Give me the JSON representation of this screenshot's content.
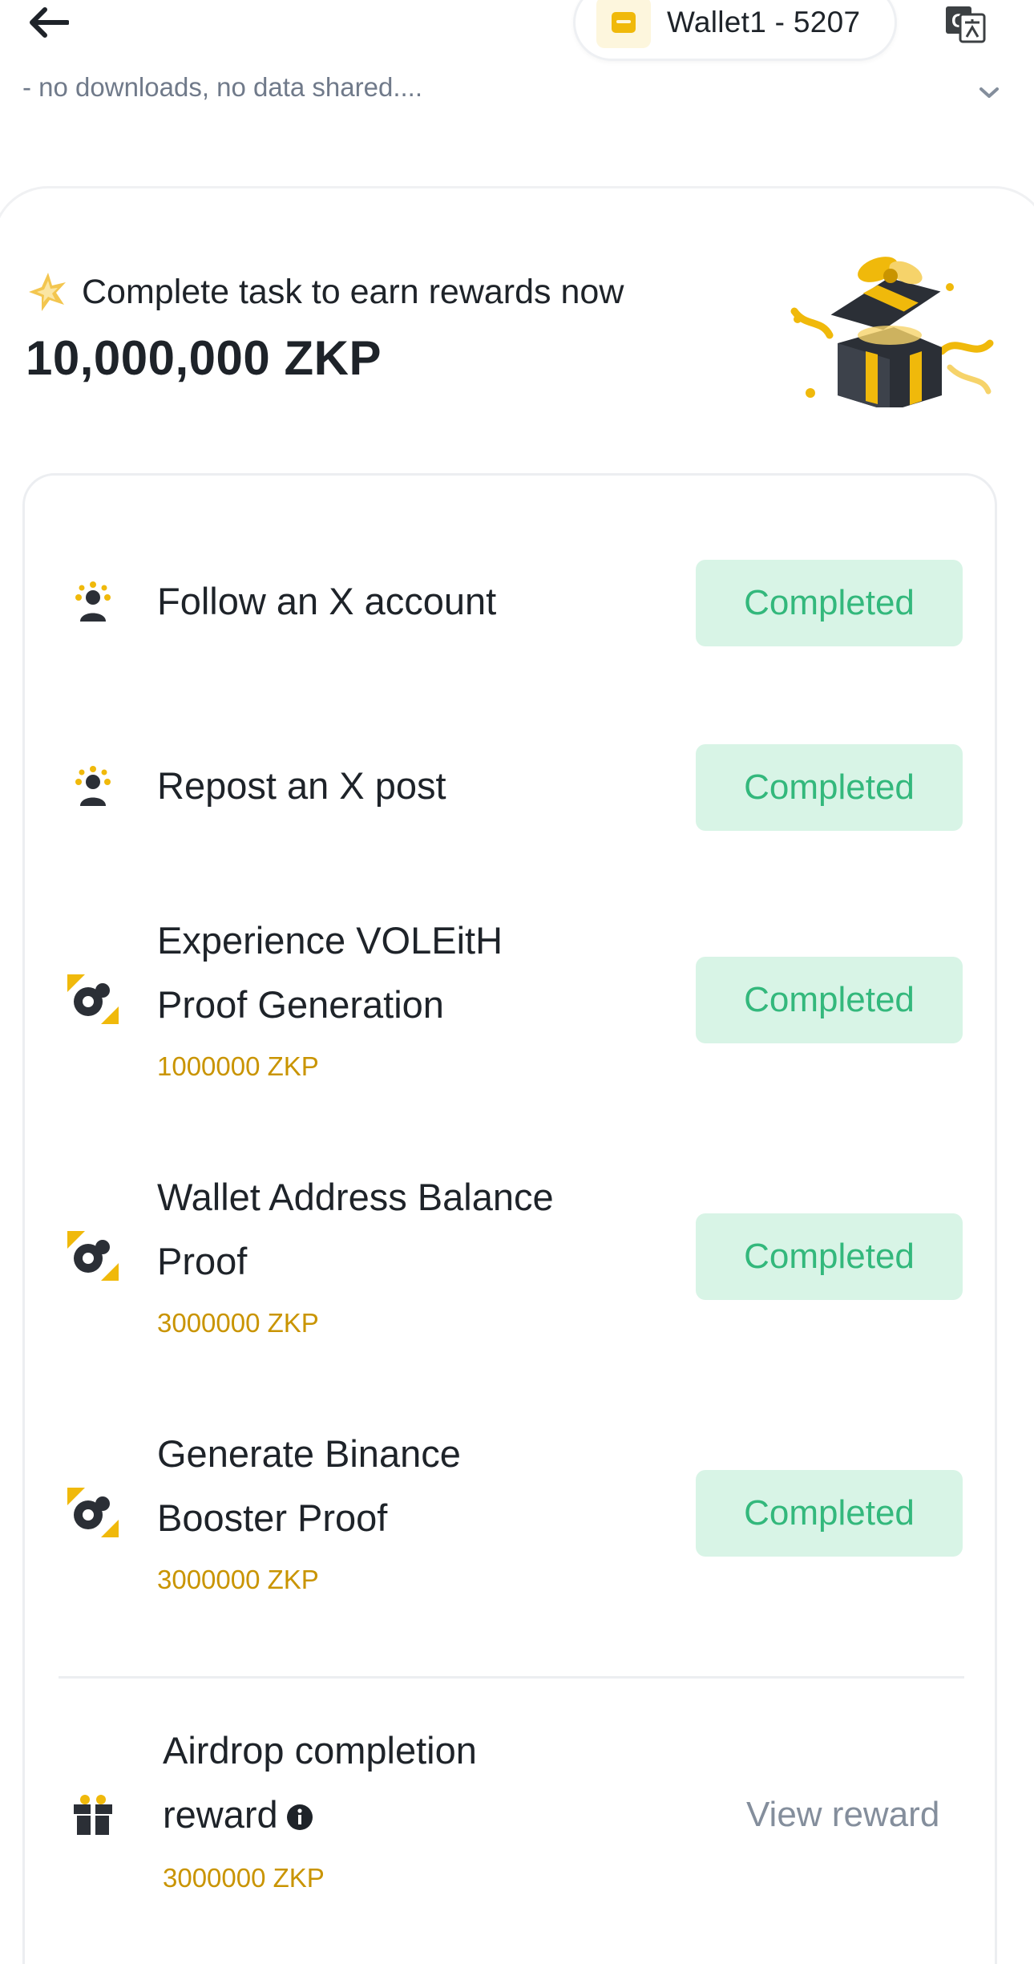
{
  "header": {
    "wallet_label": "Wallet1 - 5207",
    "subtitle": "- no downloads, no data shared...."
  },
  "hero": {
    "text": "Complete task to earn rewards now",
    "amount": "10,000,000 ZKP"
  },
  "tasks": [
    {
      "title": "Follow an X account",
      "reward": "",
      "status": "Completed",
      "icon": "people-icon"
    },
    {
      "title": "Repost an X post",
      "reward": "",
      "status": "Completed",
      "icon": "people-icon"
    },
    {
      "title": "Experience VOLEitH Proof Generation",
      "line1": "Experience VOLEitH",
      "line2": "Proof Generation",
      "reward": "1000000 ZKP",
      "status": "Completed",
      "icon": "proof-icon"
    },
    {
      "title": "Wallet Address Balance Proof",
      "line1": "Wallet Address Balance",
      "line2": "Proof",
      "reward": "3000000 ZKP",
      "status": "Completed",
      "icon": "proof-icon"
    },
    {
      "title": "Generate Binance Booster Proof",
      "line1": "Generate Binance",
      "line2": "Booster Proof",
      "reward": "3000000 ZKP",
      "status": "Completed",
      "icon": "proof-icon"
    }
  ],
  "airdrop": {
    "line1": "Airdrop completion",
    "line2": "reward",
    "reward": "3000000 ZKP",
    "action": "View reward",
    "icon": "gift-icon"
  },
  "colors": {
    "accent": "#F0B90B",
    "reward_text": "#C99400",
    "completed_bg": "#D8F4E6",
    "completed_text": "#33B87C",
    "muted": "#848E9C"
  }
}
